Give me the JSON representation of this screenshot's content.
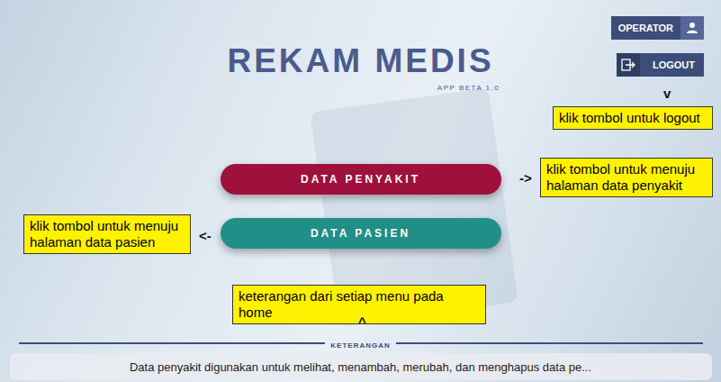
{
  "app": {
    "title": "REKAM MEDIS",
    "version": "APP BETA 1.0"
  },
  "user": {
    "role": "OPERATOR",
    "logout": "LOGOUT"
  },
  "menu": [
    {
      "label": "DATA PENYAKIT",
      "color": "#a0103c"
    },
    {
      "label": "DATA PASIEN",
      "color": "#1f8f88"
    }
  ],
  "annotations": [
    {
      "text": "klik tombol untuk logout",
      "arrow": "v"
    },
    {
      "text": "klik tombol untuk menuju halaman data penyakit",
      "arrow": "->"
    },
    {
      "text": "klik tombol untuk menuju halaman data pasien",
      "arrow": "<-"
    },
    {
      "text": "keterangan dari setiap menu pada home",
      "arrow": "^"
    }
  ],
  "info": {
    "heading": "KETERANGAN",
    "text": "Data penyakit digunakan untuk melihat, menambah, merubah, dan menghapus data pe..."
  }
}
